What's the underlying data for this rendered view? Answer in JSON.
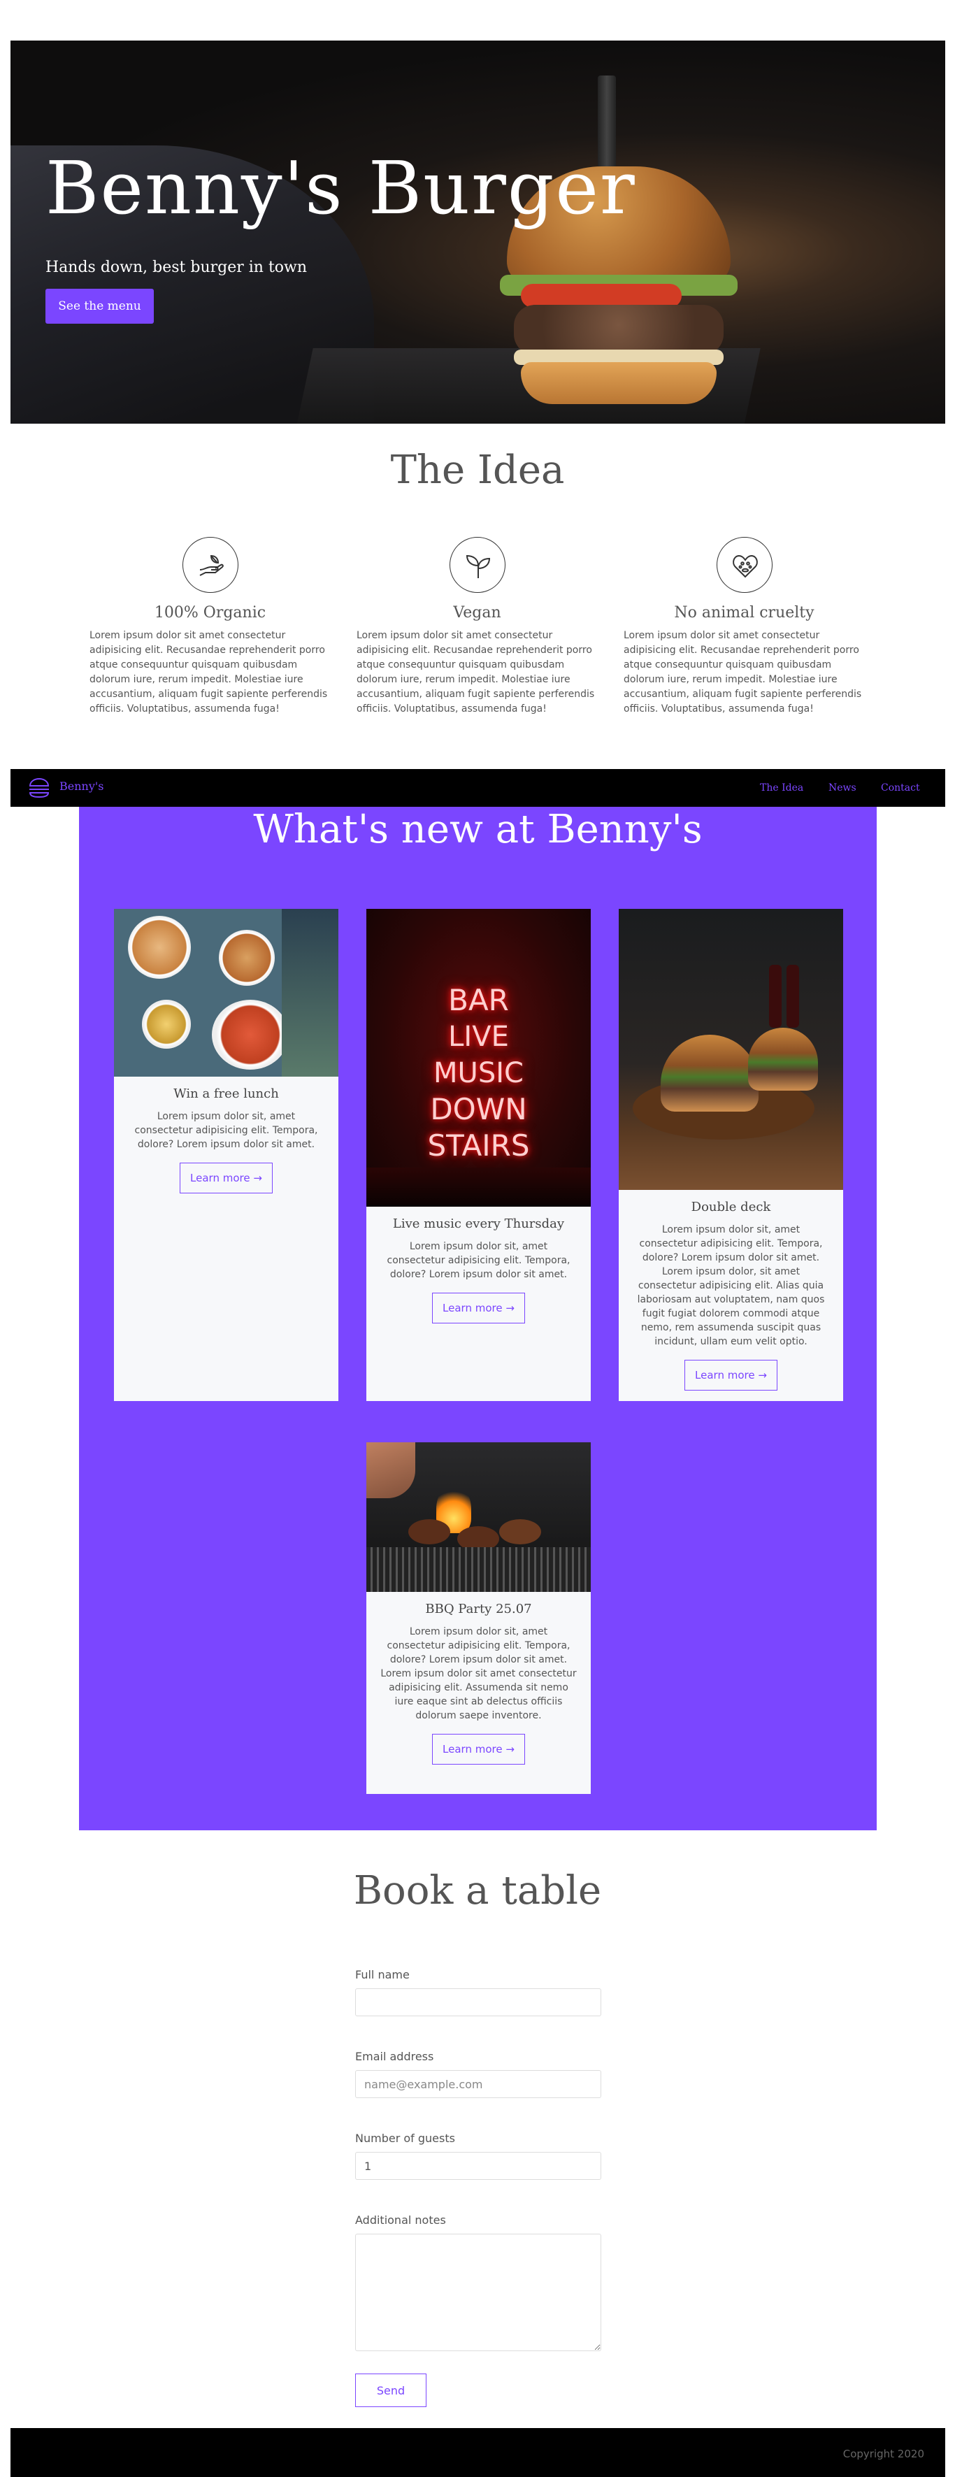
{
  "hero": {
    "title": "Benny's Burger",
    "subtitle": "Hands down, best burger in town",
    "button": "See the menu"
  },
  "idea": {
    "title": "The Idea",
    "items": [
      {
        "icon": "organic-hand-icon",
        "title": "100% Organic",
        "text": "Lorem ipsum dolor sit amet consectetur adipisicing elit. Recusandae reprehenderit porro atque consequuntur quisquam quibusdam dolorum iure, rerum impedit. Molestiae iure accusantium, aliquam fugit sapiente perferendis officiis. Voluptatibus, assumenda fuga!"
      },
      {
        "icon": "sprout-icon",
        "title": "Vegan",
        "text": "Lorem ipsum dolor sit amet consectetur adipisicing elit. Recusandae reprehenderit porro atque consequuntur quisquam quibusdam dolorum iure, rerum impedit. Molestiae iure accusantium, aliquam fugit sapiente perferendis officiis. Voluptatibus, assumenda fuga!"
      },
      {
        "icon": "heart-paw-icon",
        "title": "No animal cruelty",
        "text": "Lorem ipsum dolor sit amet consectetur adipisicing elit. Recusandae reprehenderit porro atque consequuntur quisquam quibusdam dolorum iure, rerum impedit. Molestiae iure accusantium, aliquam fugit sapiente perferendis officiis. Voluptatibus, assumenda fuga!"
      }
    ]
  },
  "navbar": {
    "brand": "Benny's",
    "links": [
      "The Idea",
      "News",
      "Contact"
    ]
  },
  "news": {
    "title": "What's new at Benny's",
    "cards": [
      {
        "title": "Win a free lunch",
        "text": "Lorem ipsum dolor sit, amet consectetur adipisicing elit. Tempora, dolore? Lorem ipsum dolor sit amet.",
        "button": "Learn more →"
      },
      {
        "title": "Live music every Thursday",
        "text": "Lorem ipsum dolor sit, amet consectetur adipisicing elit. Tempora, dolore? Lorem ipsum dolor sit amet.",
        "button": "Learn more →",
        "neon": [
          "BAR",
          "LIVE MUSIC",
          "DOWN",
          "STAIRS"
        ]
      },
      {
        "title": "Double deck",
        "text": "Lorem ipsum dolor sit, amet consectetur adipisicing elit. Tempora, dolore? Lorem ipsum dolor sit amet. Lorem ipsum dolor, sit amet consectetur adipisicing elit. Alias quia laboriosam aut voluptatem, nam quos fugit fugiat dolorem commodi atque nemo, rem assumenda suscipit quas incidunt, ullam eum velit optio.",
        "button": "Learn more →"
      },
      {
        "title": "BBQ Party 25.07",
        "text": "Lorem ipsum dolor sit, amet consectetur adipisicing elit. Tempora, dolore? Lorem ipsum dolor sit amet. Lorem ipsum dolor sit amet consectetur adipisicing elit. Assumenda sit nemo iure eaque sint ab delectus officiis dolorum saepe inventore.",
        "button": "Learn more →"
      }
    ]
  },
  "booking": {
    "title": "Book a table",
    "full_name_label": "Full name",
    "full_name_value": "",
    "email_label": "Email address",
    "email_placeholder": "name@example.com",
    "guests_label": "Number of guests",
    "guests_value": "1",
    "notes_label": "Additional notes",
    "notes_value": "",
    "send": "Send"
  },
  "footer": {
    "copyright": "Copyright 2020"
  },
  "colors": {
    "accent": "#7b46ff",
    "dark": "#000000",
    "text": "#555555"
  }
}
